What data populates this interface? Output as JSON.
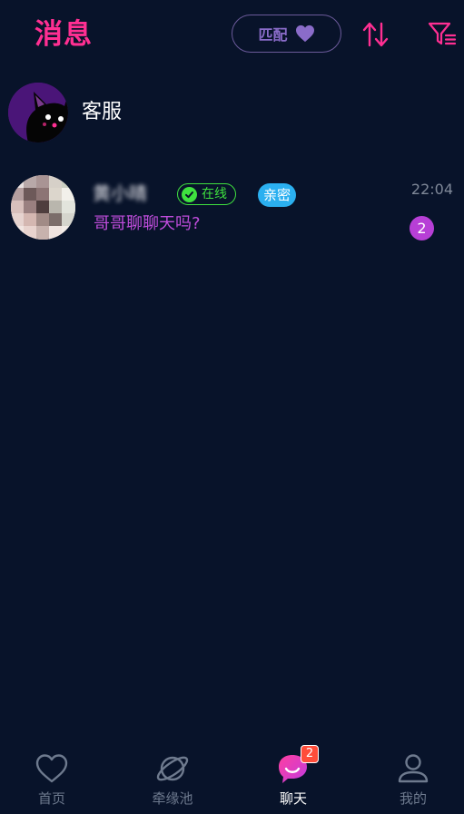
{
  "header": {
    "title": "消息",
    "match_button_label": "匹配",
    "heart_icon": "heart-icon",
    "sort_icon": "sort-arrows-icon",
    "filter_icon": "filter-icon",
    "accent_color": "#ff2f92"
  },
  "service": {
    "name": "客服",
    "avatar_icon": "cat-avatar"
  },
  "chats": [
    {
      "name": "黄小晴",
      "online_label": "在线",
      "tag_label": "亲密",
      "time": "22:04",
      "preview": "哥哥聊聊天吗?",
      "unread": "2"
    }
  ],
  "nav": {
    "items": [
      {
        "label": "首页",
        "icon": "heart-outline-icon",
        "active": false
      },
      {
        "label": "牵缘池",
        "icon": "planet-icon",
        "active": false
      },
      {
        "label": "聊天",
        "icon": "chat-bubble-icon",
        "active": true,
        "badge": "2"
      },
      {
        "label": "我的",
        "icon": "person-icon",
        "active": false
      }
    ]
  }
}
